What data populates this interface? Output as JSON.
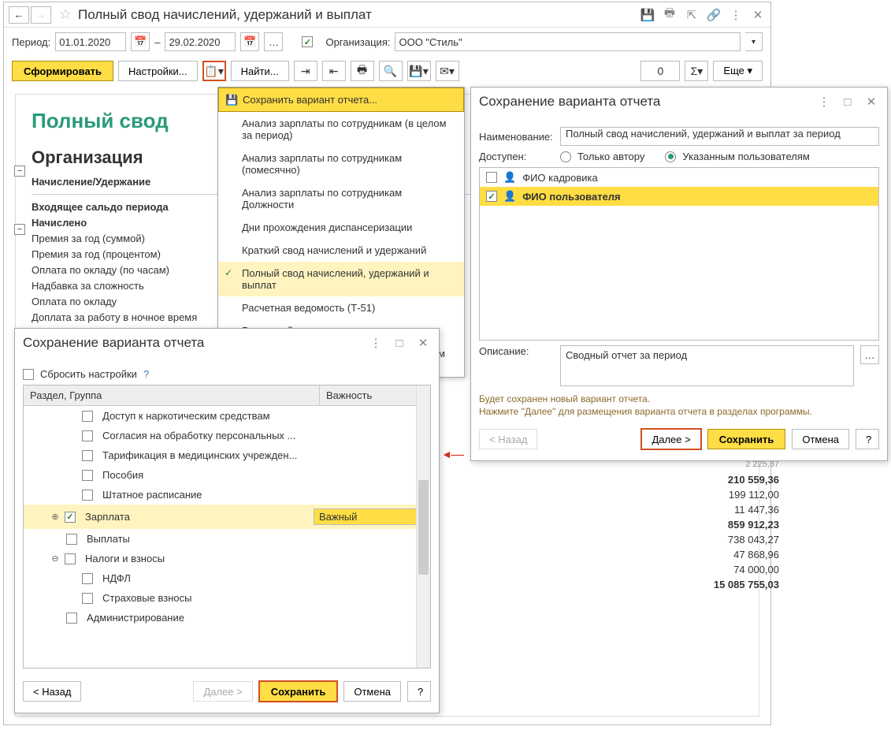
{
  "header": {
    "title": "Полный свод начислений, удержаний и выплат"
  },
  "period": {
    "label": "Период:",
    "from": "01.01.2020",
    "dash": "–",
    "to": "29.02.2020",
    "org_label": "Организация:",
    "org_value": "ООО \"Стиль\""
  },
  "toolbar": {
    "form": "Сформировать",
    "settings": "Настройки...",
    "find": "Найти...",
    "more": "Еще",
    "zero": "0"
  },
  "report": {
    "title": "Полный свод",
    "subtitle": "Организация",
    "col_header": "Начисление/Удержание",
    "rows": [
      {
        "text": "Входящее сальдо периода",
        "bold": true
      },
      {
        "text": "Начислено",
        "bold": true
      },
      {
        "text": "Премия за год (суммой)"
      },
      {
        "text": "Премия за год (процентом)"
      },
      {
        "text": "Оплата по окладу (по часам)"
      },
      {
        "text": "Надбавка за сложность"
      },
      {
        "text": "Оплата по окладу"
      },
      {
        "text": "Доплата за работу в ночное время"
      }
    ]
  },
  "values": [
    {
      "text": "210 559,36",
      "bold": true
    },
    {
      "text": "199 112,00"
    },
    {
      "text": "11 447,36"
    },
    {
      "text": "859 912,23",
      "bold": true
    },
    {
      "text": "738 043,27"
    },
    {
      "text": "47 868,96"
    },
    {
      "text": "74 000,00"
    },
    {
      "text": "15 085 755,03",
      "bold": true
    }
  ],
  "menu": {
    "items": [
      {
        "text": "Сохранить вариант отчета...",
        "hl": "yellow",
        "icon": "save"
      },
      {
        "text": "Анализ зарплаты по сотрудникам (в целом за период)"
      },
      {
        "text": "Анализ зарплаты по сотрудникам (помесячно)"
      },
      {
        "text": "Анализ зарплаты по сотрудникам Должности"
      },
      {
        "text": "Дни прохождения диспансеризации"
      },
      {
        "text": "Краткий свод начислений и удержаний"
      },
      {
        "text": "Полный свод начислений, удержаний и выплат",
        "hl": "light",
        "check": true
      },
      {
        "text": "Расчетная ведомость (Т-51)"
      },
      {
        "text": "Расчетный листок"
      },
      {
        "text": "Расчетный листок с разбивкой по рабочим местам"
      }
    ]
  },
  "dialog_right": {
    "title": "Сохранение варианта отчета",
    "name_label": "Наименование:",
    "name_value": "Полный свод начислений, удержаний и выплат за период",
    "avail_label": "Доступен:",
    "radio_author": "Только автору",
    "radio_users": "Указанным пользователям",
    "users": [
      {
        "name": "ФИО кадровика",
        "checked": false
      },
      {
        "name": "ФИО пользователя",
        "checked": true,
        "hl": true
      }
    ],
    "desc_label": "Описание:",
    "desc_value": "Сводный отчет за период",
    "info1": "Будет сохранен новый вариант отчета.",
    "info2": "Нажмите \"Далее\" для размещения варианта отчета в разделах программы.",
    "back": "< Назад",
    "next": "Далее >",
    "save": "Сохранить",
    "cancel": "Отмена",
    "help": "?"
  },
  "dialog_left": {
    "title": "Сохранение варианта отчета",
    "reset": "Сбросить настройки",
    "help_q": "?",
    "col_section": "Раздел, Группа",
    "col_importance": "Важность",
    "sections": [
      {
        "text": "Доступ к наркотическим средствам",
        "indent": 2
      },
      {
        "text": "Согласия на обработку персональных ...",
        "indent": 2
      },
      {
        "text": "Тарификация в медицинских учрежден...",
        "indent": 2
      },
      {
        "text": "Пособия",
        "indent": 2
      },
      {
        "text": "Штатное расписание",
        "indent": 2
      },
      {
        "text": "Зарплата",
        "indent": 1,
        "checked": true,
        "expand": "plus",
        "hl": true,
        "importance": "Важный"
      },
      {
        "text": "Выплаты",
        "indent": 1
      },
      {
        "text": "Налоги и взносы",
        "indent": 1,
        "expand": "minus"
      },
      {
        "text": "НДФЛ",
        "indent": 2
      },
      {
        "text": "Страховые взносы",
        "indent": 2
      },
      {
        "text": "Администрирование",
        "indent": 1
      }
    ],
    "back": "< Назад",
    "next": "Далее >",
    "save": "Сохранить",
    "cancel": "Отмена",
    "help": "?"
  }
}
